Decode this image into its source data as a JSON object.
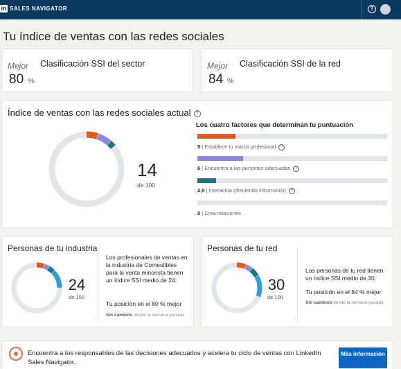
{
  "header": {
    "logo": "in",
    "brand": "SALES NAVIGATOR",
    "help": "?"
  },
  "page_title": "Tu índice de ventas con las redes sociales",
  "sector_card": {
    "label": "Mejor",
    "title": "Clasificación SSI del sector",
    "value": "80",
    "unit": "%"
  },
  "network_card": {
    "label": "Mejor",
    "title": "Clasificación SSI de la red",
    "value": "84",
    "unit": "%"
  },
  "ssi": {
    "title": "Índice de ventas con las redes sociales actual",
    "score": "14",
    "of": "de 100",
    "score_value": 14,
    "factors_title": "Los cuatro factores que determinan tu puntuación",
    "factors": [
      {
        "value": "5",
        "label": "Establece tu marca profesional",
        "num": 5,
        "max": 25,
        "color": "#e15b0b"
      },
      {
        "value": "6",
        "label": "Encuentra a las personas adecuadas",
        "num": 6,
        "max": 25,
        "color": "#8d86e0"
      },
      {
        "value": "2,5",
        "label": "Interactúa ofreciendo información",
        "num": 2.5,
        "max": 25,
        "color": "#1a7884"
      },
      {
        "value": "0",
        "label": "Crea relaciones",
        "num": 0,
        "max": 25,
        "color": "#2e9fd6"
      }
    ]
  },
  "industry": {
    "title": "Personas de tu industria",
    "score": "24",
    "of": "de 100",
    "text": "Los profesionales de ventas en la industria de Comestibles para la venta minorista tienen un índice SSI medio de 24.",
    "rank": "Tu posición en el 80 % mejor",
    "change_bold": "Sin cambios",
    "change_rest": "desde la semana pasada",
    "segments": [
      5,
      3,
      4,
      12
    ]
  },
  "network": {
    "title": "Personas de tu red",
    "score": "30",
    "of": "de 100",
    "text": "Las personas de tu red tienen un índice SSI medio de 30.",
    "rank": "Tu posición en el 84 % mejor",
    "change_bold": "Sin cambios",
    "change_rest": "desde la semana pasada",
    "segments": [
      6,
      4,
      6,
      14
    ]
  },
  "banner": {
    "text": "Encuentra a los responsables de las decisiones adecuados y acelera tu ciclo de ventas con LinkedIn Sales Navigator.",
    "button": "Más información"
  },
  "colors": {
    "brand": "#0a3a5f",
    "button": "#0a66c2",
    "track": "#e1e6ea"
  }
}
